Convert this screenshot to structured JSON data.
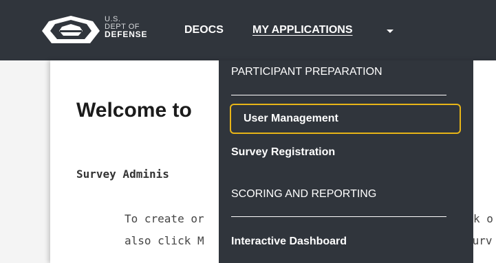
{
  "header": {
    "logo": {
      "line1": "U.S.",
      "line2": "DEPT OF",
      "line3": "DEFENSE",
      "icon": "pentagon-icon"
    },
    "nav": {
      "deocs": "DEOCS",
      "my_applications": "MY APPLICATIONS"
    },
    "caret_icon": "chevron-down-icon"
  },
  "main": {
    "welcome": "Welcome to",
    "subhead": "Survey Adminis",
    "para_line1": "To create or",
    "para_line1_tail": "k o",
    "para_line2": "also click M",
    "para_line2_tail": "Surv"
  },
  "dropdown": {
    "section1_title": "PARTICIPANT PREPARATION",
    "item_user_management": "User Management",
    "item_survey_registration": "Survey Registration",
    "section2_title": "SCORING AND REPORTING",
    "item_interactive_dashboard": "Interactive Dashboard"
  },
  "colors": {
    "navbar": "#30353c",
    "focus_ring": "#e8b517",
    "card": "#ffffff"
  }
}
